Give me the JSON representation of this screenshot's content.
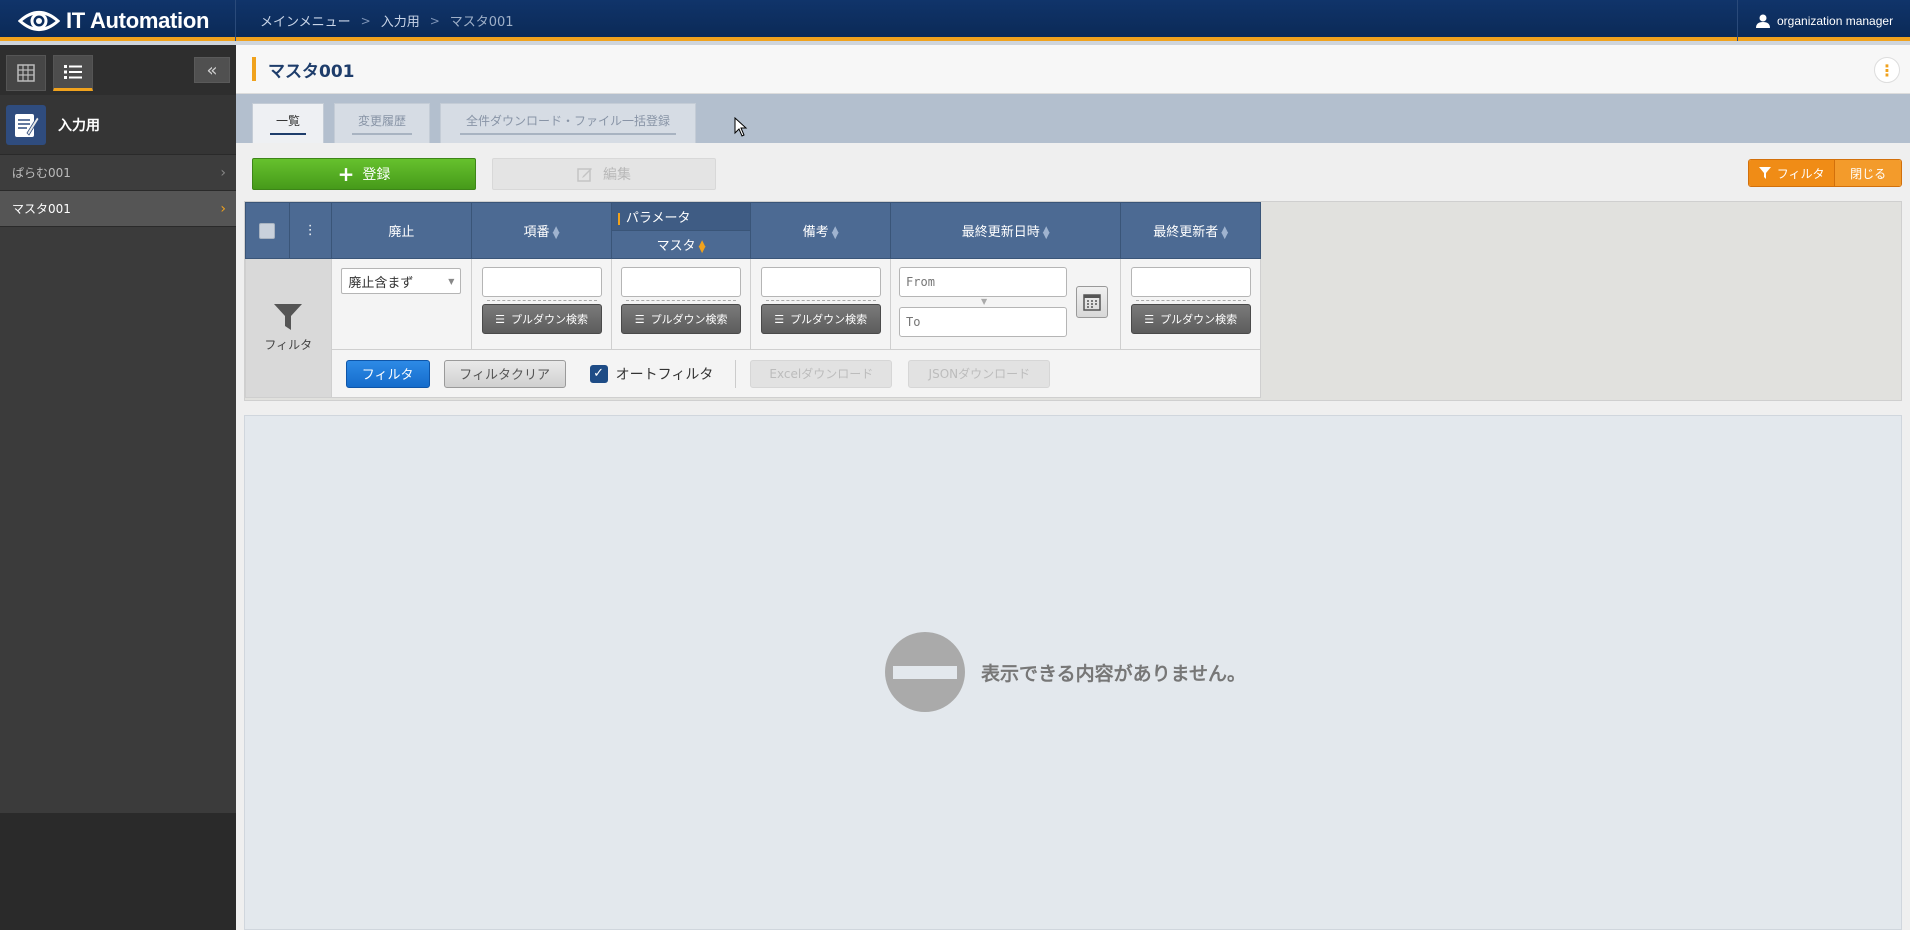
{
  "app": {
    "name": "IT Automation",
    "user": "organization manager"
  },
  "breadcrumb": {
    "items": [
      "メインメニュー",
      "入力用",
      "マスタ001"
    ]
  },
  "sidebar": {
    "menu_title": "入力用",
    "items": [
      {
        "label": "ぱらむ001",
        "active": false
      },
      {
        "label": "マスタ001",
        "active": true
      }
    ]
  },
  "page": {
    "title": "マスタ001"
  },
  "tabs": [
    {
      "label": "一覧",
      "active": true
    },
    {
      "label": "変更履歴",
      "active": false
    },
    {
      "label": "全件ダウンロード・ファイル一括登録",
      "active": false
    }
  ],
  "toolbar": {
    "register_label": "登録",
    "edit_label": "編集",
    "filter_label": "フィルタ",
    "close_label": "閉じる"
  },
  "grid": {
    "columns": {
      "discard": "廃止",
      "item_no": "項番",
      "param_group": "パラメータ",
      "master": "マスタ",
      "remarks": "備考",
      "last_updated": "最終更新日時",
      "last_updater": "最終更新者"
    },
    "filter_row_label": "フィルタ",
    "discard_select_value": "廃止含まず",
    "pulldown_label": "プルダウン検索",
    "date_from_placeholder": "From",
    "date_to_placeholder": "To"
  },
  "filter_actions": {
    "filter_label": "フィルタ",
    "clear_label": "フィルタクリア",
    "auto_filter_label": "オートフィルタ",
    "auto_filter_checked": true,
    "excel_label": "Excelダウンロード",
    "json_label": "JSONダウンロード"
  },
  "empty": {
    "message": "表示できる内容がありません。"
  },
  "colors": {
    "header": "#10346a",
    "accent": "#f0a21d",
    "register": "#469a1a",
    "filter_toggle": "#f08c16",
    "filter_button": "#156ccc"
  }
}
